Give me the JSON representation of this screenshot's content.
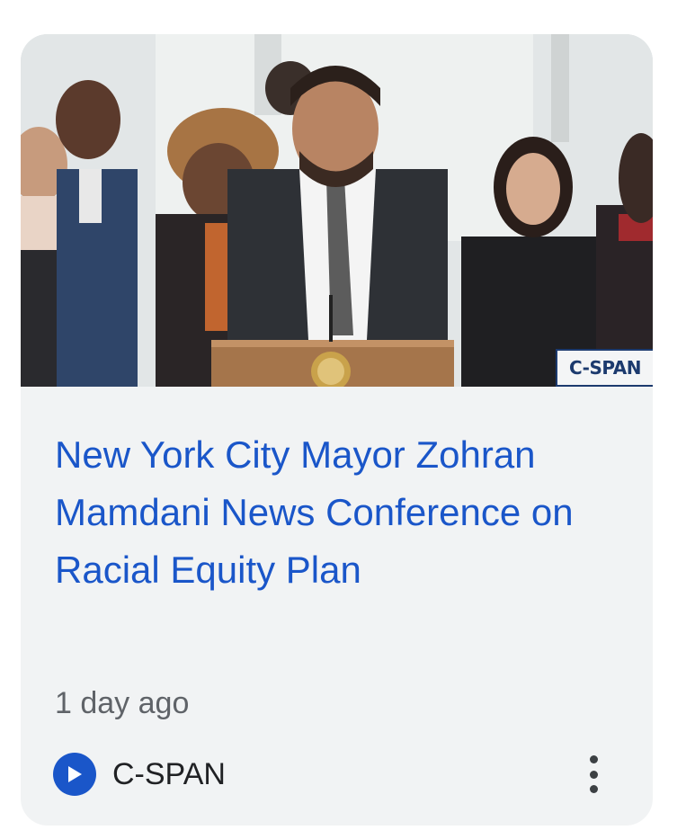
{
  "card": {
    "thumbnail_watermark": "C-SPAN",
    "title": "New York City Mayor Zohran Mamdani News Conference on Racial Equity Plan",
    "time_ago": "1 day ago",
    "source": {
      "name": "C-SPAN",
      "icon": "play-icon"
    },
    "menu_icon": "more-vert-icon"
  },
  "colors": {
    "title_link": "#1a56c9",
    "card_background": "#f1f3f4",
    "meta_text": "#5f6368"
  }
}
